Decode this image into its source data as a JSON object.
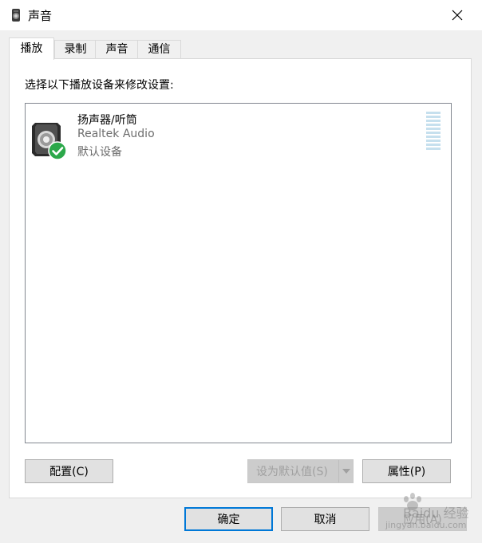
{
  "window": {
    "title": "声音"
  },
  "tabs": [
    {
      "label": "播放",
      "active": true
    },
    {
      "label": "录制",
      "active": false
    },
    {
      "label": "声音",
      "active": false
    },
    {
      "label": "通信",
      "active": false
    }
  ],
  "panel": {
    "instruction": "选择以下播放设备来修改设置:",
    "devices": [
      {
        "name": "扬声器/听筒",
        "driver": "Realtek Audio",
        "status": "默认设备",
        "icon": "speaker-icon",
        "badge": "default-check-icon"
      }
    ]
  },
  "buttons": {
    "configure": "配置(C)",
    "set_default": "设为默认值(S)",
    "properties": "属性(P)",
    "ok": "确定",
    "cancel": "取消",
    "apply": "应用(A)"
  },
  "watermark": {
    "line1": "Baidu 经验",
    "line2": "jingyan.baidu.com"
  },
  "colors": {
    "accent": "#0078d7",
    "check_badge": "#2ba84a",
    "meter": "#c6e0ee"
  }
}
